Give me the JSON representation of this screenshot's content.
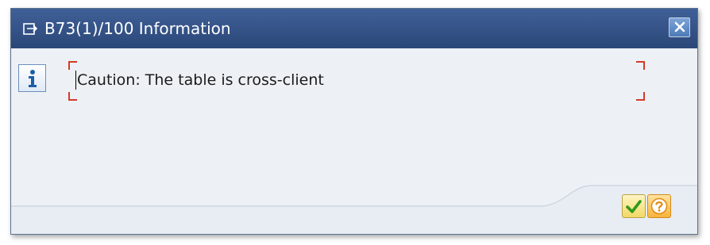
{
  "window": {
    "title": "B73(1)/100 Information",
    "title_icon": "dialog-window-icon",
    "close_icon": "close-icon"
  },
  "message": {
    "icon": "info-icon",
    "text": "Caution: The table is cross-client"
  },
  "buttons": {
    "continue_icon": "green-checkmark-icon",
    "help_icon": "question-mark-icon"
  },
  "colors": {
    "titlebar": "#2f4c7f",
    "body": "#edf1f6",
    "focus_corners": "#d43a2a",
    "checkmark": "#2f9a1c",
    "help": "#f8b43b"
  }
}
